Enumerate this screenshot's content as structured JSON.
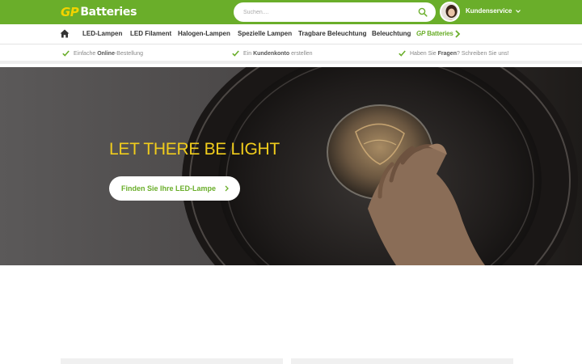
{
  "header": {
    "logo_gp": "GP",
    "logo_text": "Batteries",
    "search_placeholder": "Suchen....",
    "service_label": "Kundenservice"
  },
  "nav": {
    "items": [
      "LED-Lampen",
      "LED Filament",
      "Halogen-Lampen",
      "Spezielle Lampen",
      "Tragbare Beleuchtung",
      "Beleuchtung"
    ],
    "gp_prefix": "GP",
    "gp_suffix": "Batteries"
  },
  "usp": {
    "item1_pre": "Einfache ",
    "item1_bold": "Online",
    "item1_post": "-Bestellung",
    "item2_pre": "Ein ",
    "item2_bold": "Kundenkonto",
    "item2_post": " erstellen",
    "item3_pre": "Haben Sie ",
    "item3_bold": "Fragen",
    "item3_post": "? Schreiben Sie uns!"
  },
  "hero": {
    "title": "LET THERE BE LIGHT",
    "button_label": "Finden Sie Ihre LED-Lampe"
  },
  "colors": {
    "brand_green": "#6aae2a",
    "brand_yellow": "#f2d300",
    "hero_title": "#f0cc1c"
  }
}
